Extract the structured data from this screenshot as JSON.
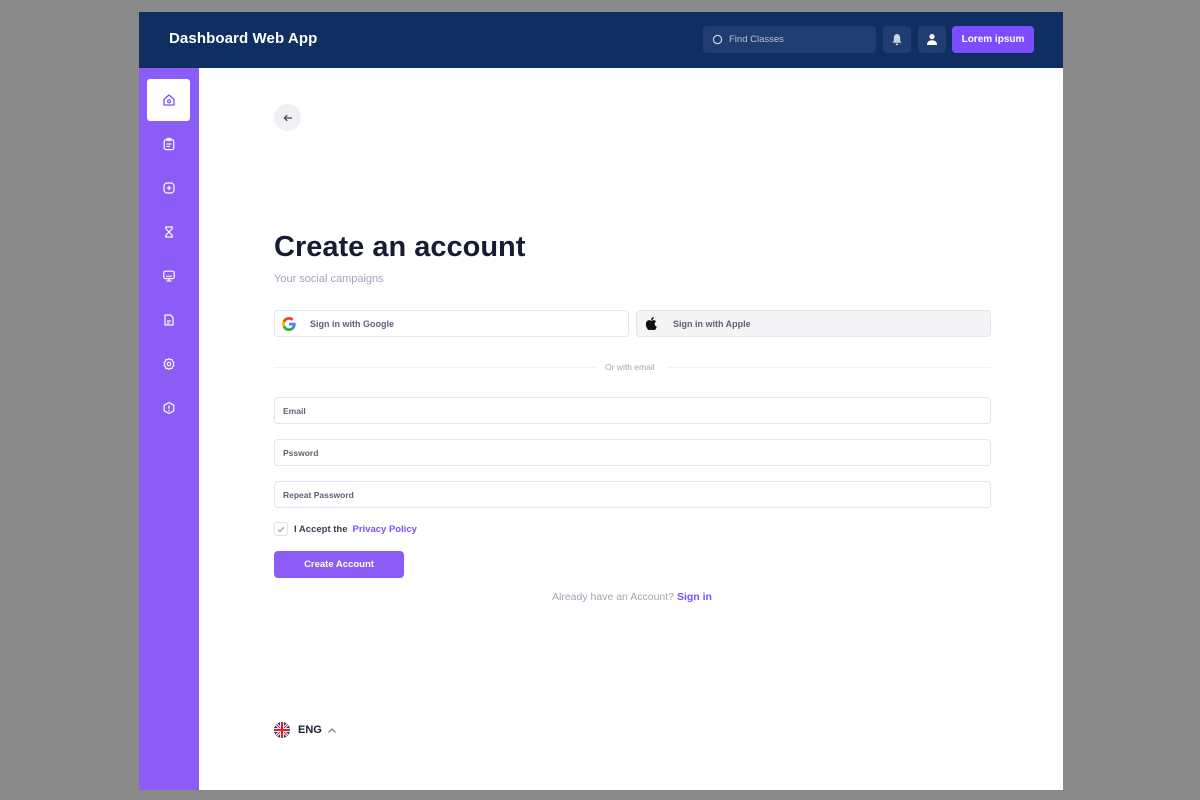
{
  "header": {
    "app_title": "Dashboard Web App",
    "search_placeholder": "Find Classes",
    "cta_label": "Lorem ipsum"
  },
  "sidebar": {
    "items": [
      {
        "icon": "home-icon",
        "active": true
      },
      {
        "icon": "clipboard-icon",
        "active": false
      },
      {
        "icon": "add-square-icon",
        "active": false
      },
      {
        "icon": "hourglass-icon",
        "active": false
      },
      {
        "icon": "monitor-icon",
        "active": false
      },
      {
        "icon": "document-icon",
        "active": false
      },
      {
        "icon": "settings-icon",
        "active": false
      },
      {
        "icon": "warning-icon",
        "active": false
      }
    ]
  },
  "form": {
    "title": "Create an account",
    "subtitle": "Your social campaigns",
    "google_label": "Sign in with Google",
    "apple_label": "Sign in with Apple",
    "divider_text": "Or with email",
    "email_placeholder": "Email",
    "password_placeholder": "Pssword",
    "repeat_password_placeholder": "Repeat Password",
    "accept_text": "I Accept the",
    "policy_link": "Privacy Policy",
    "terms_checked": true,
    "submit_label": "Create Account",
    "already_text": "Already have an Account?",
    "signin_link": "Sign in"
  },
  "language": {
    "code": "ENG"
  },
  "colors": {
    "topbar": "#0f2f63",
    "sidebar": "#8b5cf6",
    "accent": "#7c4dff"
  }
}
